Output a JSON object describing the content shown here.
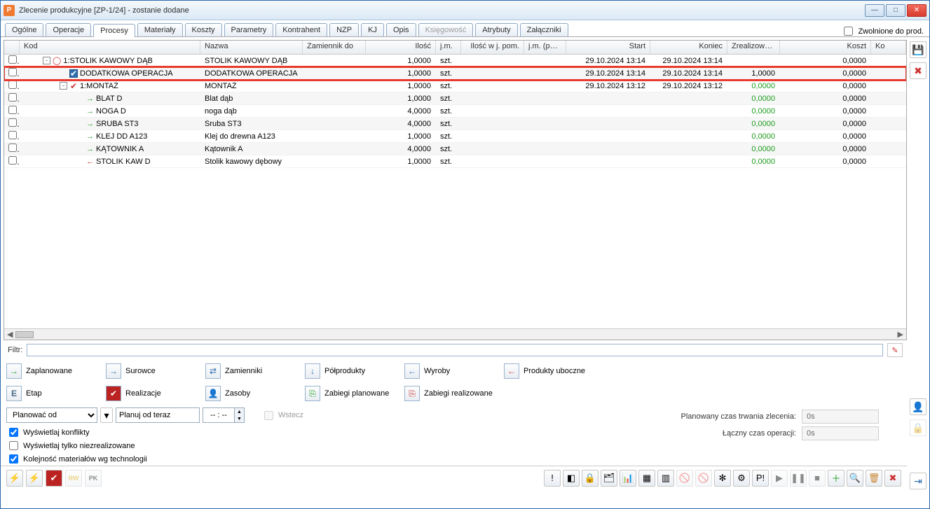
{
  "window": {
    "title": "Zlecenie produkcyjne  [ZP-1/24] - zostanie dodane",
    "icon_letter": "P"
  },
  "release_chk_label": "Zwolnione do prod.",
  "tabs": [
    {
      "label": "Ogólne"
    },
    {
      "label": "Operacje"
    },
    {
      "label": "Procesy",
      "active": true
    },
    {
      "label": "Materiały"
    },
    {
      "label": "Koszty"
    },
    {
      "label": "Parametry"
    },
    {
      "label": "Kontrahent"
    },
    {
      "label": "NZP"
    },
    {
      "label": "KJ"
    },
    {
      "label": "Opis"
    },
    {
      "label": "Księgowość",
      "disabled": true
    },
    {
      "label": "Atrybuty"
    },
    {
      "label": "Załączniki"
    }
  ],
  "columns": {
    "chk": "",
    "kod": "Kod",
    "nazwa": "Nazwa",
    "zamiennik": "Zamiennik do",
    "ilosc": "Ilość",
    "jm": "j.m.",
    "iloscwjpom": "Ilość w j. pom.",
    "jmpom": "j.m. (pom)",
    "start": "Start",
    "koniec": "Koniec",
    "zreal": "Zrealizowano",
    "koszt": "Koszt",
    "ko": "Ko"
  },
  "rows": [
    {
      "indent": 0,
      "exp": "-",
      "icon": "cycle",
      "kod": "1:STOLIK KAWOWY DĄB",
      "nazwa": "STOLIK KAWOWY DĄB",
      "ilosc": "1,0000",
      "jm": "szt.",
      "start": "29.10.2024 13:14",
      "koniec": "29.10.2024 13:14",
      "zreal": "",
      "koszt": "0,0000"
    },
    {
      "indent": 1,
      "icon": "blue-check",
      "kod": "DODATKOWA OPERACJA",
      "nazwa": "DODATKOWA OPERACJA",
      "ilosc": "1,0000",
      "jm": "szt.",
      "start": "29.10.2024 13:14",
      "koniec": "29.10.2024 13:14",
      "zreal": "1,0000",
      "zreal_green": false,
      "koszt": "0,0000",
      "highlight": true
    },
    {
      "indent": 1,
      "exp": "-",
      "icon": "red-check",
      "kod": "1:MONTAŻ",
      "nazwa": "MONTAŻ",
      "ilosc": "1,0000",
      "jm": "szt.",
      "start": "29.10.2024 13:12",
      "koniec": "29.10.2024 13:12",
      "zreal": "0,0000",
      "zreal_green": true,
      "koszt": "0,0000"
    },
    {
      "indent": 2,
      "icon": "arrow-g",
      "kod": "BLAT D",
      "nazwa": "Blat dąb",
      "ilosc": "1,0000",
      "jm": "szt.",
      "zreal": "0,0000",
      "zreal_green": true,
      "koszt": "0,0000"
    },
    {
      "indent": 2,
      "icon": "arrow-g",
      "kod": "NOGA D",
      "nazwa": "noga dąb",
      "ilosc": "4,0000",
      "jm": "szt.",
      "zreal": "0,0000",
      "zreal_green": true,
      "koszt": "0,0000"
    },
    {
      "indent": 2,
      "icon": "arrow-g",
      "kod": "ŚRUBA ST3",
      "nazwa": "Śruba ST3",
      "ilosc": "4,0000",
      "jm": "szt.",
      "zreal": "0,0000",
      "zreal_green": true,
      "koszt": "0,0000"
    },
    {
      "indent": 2,
      "icon": "arrow-g",
      "kod": "KLEJ DD A123",
      "nazwa": "Klej do drewna A123",
      "ilosc": "1,0000",
      "jm": "szt.",
      "zreal": "0,0000",
      "zreal_green": true,
      "koszt": "0,0000"
    },
    {
      "indent": 2,
      "icon": "arrow-g",
      "kod": "KĄTOWNIK A",
      "nazwa": "Kątownik A",
      "ilosc": "4,0000",
      "jm": "szt.",
      "zreal": "0,0000",
      "zreal_green": true,
      "koszt": "0,0000"
    },
    {
      "indent": 2,
      "icon": "arrow-r",
      "kod": "STOLIK KAW D",
      "nazwa": "Stolik kawowy dębowy",
      "ilosc": "1,0000",
      "jm": "szt.",
      "zreal": "0,0000",
      "zreal_green": true,
      "koszt": "0,0000"
    }
  ],
  "filter_label": "Filtr:",
  "action_buttons_row1": [
    {
      "icon": "→",
      "color": "#1c9c1c",
      "label": "Zaplanowane"
    },
    {
      "icon": "→",
      "color": "#2f6fb0",
      "label": "Surowce"
    },
    {
      "icon": "⇄",
      "color": "#2f6fb0",
      "label": "Zamienniki"
    },
    {
      "icon": "↓",
      "color": "#2f6fb0",
      "label": "Półprodukty"
    },
    {
      "icon": "←",
      "color": "#2f6fb0",
      "label": "Wyroby"
    },
    {
      "icon": "←",
      "color": "#cc3a2e",
      "label": "Produkty uboczne"
    }
  ],
  "action_buttons_row2": [
    {
      "icon": "E",
      "cls": "e",
      "label": "Etap"
    },
    {
      "icon": "✔",
      "color": "#c33",
      "bg": "#b22",
      "label": "Realizacje"
    },
    {
      "icon": "👤",
      "label": "Zasoby"
    },
    {
      "icon": "⎘",
      "color": "#1c9c1c",
      "label": "Zabiegi planowane"
    },
    {
      "icon": "⎘",
      "color": "#c33",
      "label": "Zabiegi realizowane"
    }
  ],
  "plan_dropdown": "Planować od",
  "plan_from_now": "Planuj od teraz",
  "time_spin": "-- : --",
  "back_chk": "Wstecz",
  "cb1": "Wyświetlaj konflikty",
  "cb2": "Wyświetlaj tylko niezrealizowane",
  "cb3": "Kolejność materiałów wg technologii",
  "info_planned_label": "Planowany czas trwania zlecenia:",
  "info_planned_val": "0s",
  "info_total_label": "Łączny czas operacji:",
  "info_total_val": "0s",
  "bottom_left_icons": [
    "⚡",
    "⚡",
    "✔",
    "RW",
    "PK"
  ],
  "bottom_right_icons": [
    "!",
    "◧",
    "🔒",
    "🗂",
    "📊",
    "▦",
    "▥",
    "🚫",
    "🚫",
    "✻",
    "⚙",
    "P!",
    "▶",
    "❚❚",
    "■",
    "＋",
    "🔍",
    "🗑",
    "✖"
  ]
}
